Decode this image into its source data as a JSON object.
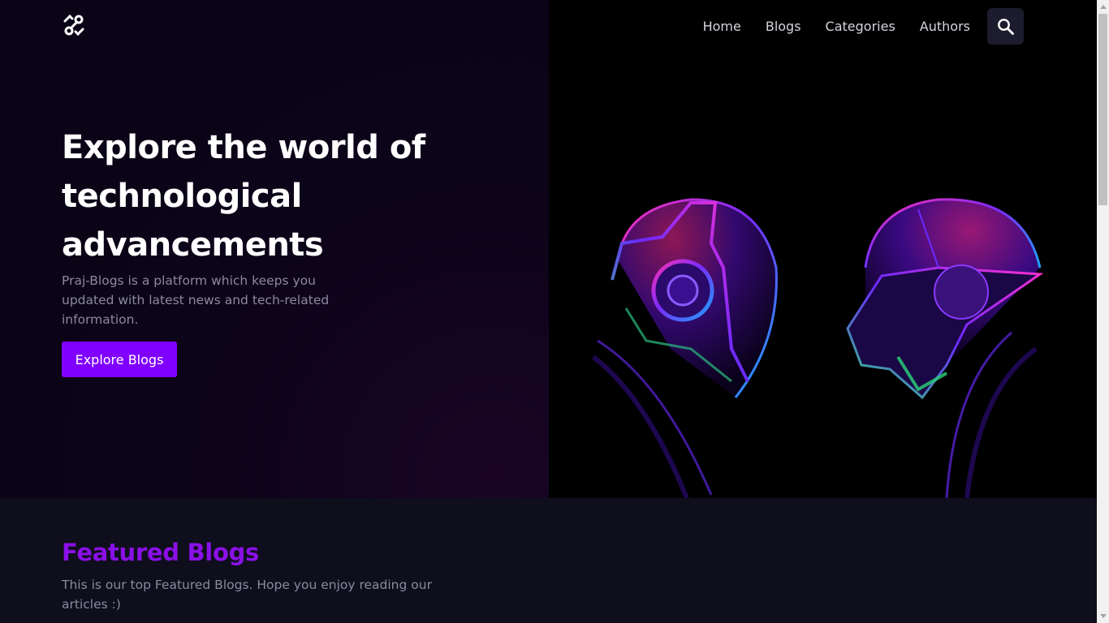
{
  "nav": {
    "links": [
      "Home",
      "Blogs",
      "Categories",
      "Authors"
    ],
    "search_icon": "search-icon",
    "logo_icon": "link-logo-icon"
  },
  "hero": {
    "title": "Explore the world of technological advancements",
    "description": "Praj-Blogs is a platform which keeps you updated with latest news and tech-related information.",
    "cta_label": "Explore Blogs",
    "image": "neon-helmets-illustration"
  },
  "featured": {
    "title": "Featured Blogs",
    "description": "This is our top Featured Blogs. Hope you enjoy reading our articles :)"
  },
  "colors": {
    "accent": "#8000ff",
    "featured_title": "#8a10e8",
    "background": "#0f0e1c",
    "hero_left": "#0b0417"
  }
}
